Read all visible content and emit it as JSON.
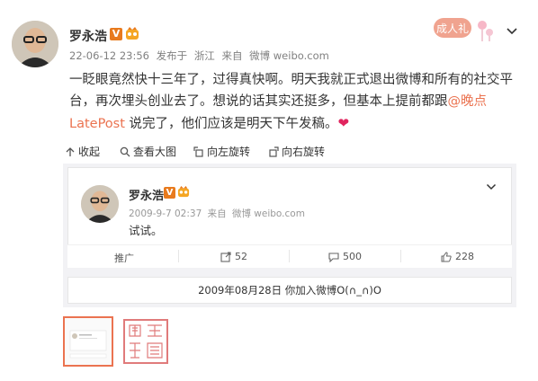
{
  "post": {
    "author": "罗永浩",
    "date": "22-06-12 23:56",
    "published_label": "发布于",
    "location": "浙江",
    "source_label": "来自",
    "source": "微博 weibo.com",
    "text_line1": "一眨眼竟然快十三年了，过得真快啊。明天我就正式退出微博和所有的社交平",
    "text_line2": "台，再次埋头创业去了。想说的话其实还挺多，但基本上提前都跟",
    "mention": "@晚点",
    "text_line3_link": "LatePost",
    "text_line3_rest": " 说完了，他们应该是明天下午发稿。",
    "heart": "❤",
    "stamp_text": "成人礼",
    "verified_glyph": "V"
  },
  "toolbar": {
    "collect": "收起",
    "view_large": "查看大图",
    "rotate_left": "向左旋转",
    "rotate_right": "向右旋转"
  },
  "retweet": {
    "author": "罗永浩",
    "date": "2009-9-7 02:37",
    "source_label": "来自",
    "source": "微博 weibo.com",
    "text": "试试。",
    "promote": "推广",
    "reposts": "52",
    "comments": "500",
    "likes": "228",
    "verified_glyph": "V"
  },
  "notice": {
    "text": "2009年08月28日  你加入微博O(∩_∩)O"
  },
  "colors": {
    "accent": "#eb7350",
    "verified": "#e87a1d",
    "muted": "#808080"
  }
}
